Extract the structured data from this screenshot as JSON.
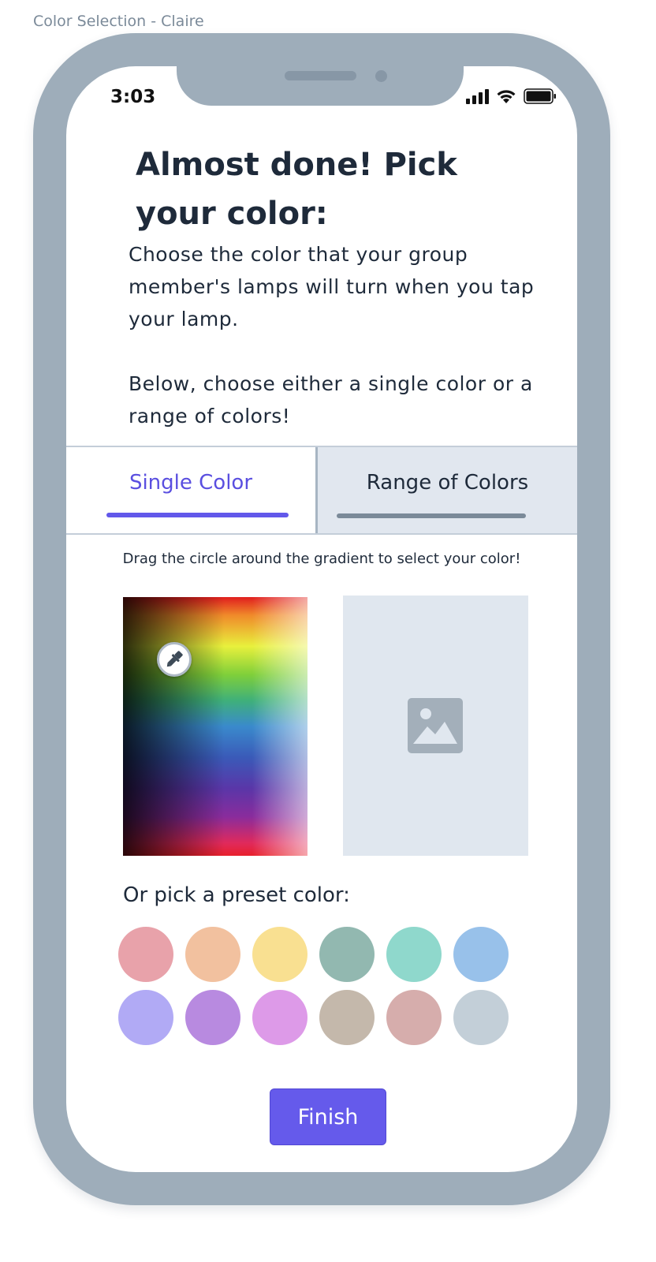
{
  "frame_label": "Color Selection - Claire",
  "status_bar": {
    "time": "3:03"
  },
  "heading": "Almost done! Pick your color:",
  "intro": {
    "paragraph1": "Choose the color that your group member's lamps will turn when you tap your lamp.",
    "paragraph2": "Below, choose either a single color or a range of colors!"
  },
  "tabs": [
    {
      "label": "Single Color",
      "active": true
    },
    {
      "label": "Range of Colors",
      "active": false
    }
  ],
  "hint": "Drag the circle around the gradient to select your color!",
  "preset_label": "Or pick a preset color:",
  "presets": [
    "#e8a2aa",
    "#f2c19f",
    "#f9e091",
    "#92b8b0",
    "#8fd8cc",
    "#98c1ea",
    "#b1aaf5",
    "#b88ae0",
    "#dd9ae8",
    "#c4b8ab",
    "#d6adac",
    "#c3cfd8"
  ],
  "finish_label": "Finish",
  "colors": {
    "accent": "#655aeb",
    "phone_frame": "#9eadba",
    "tab_inactive_bg": "#e1e7ef"
  }
}
